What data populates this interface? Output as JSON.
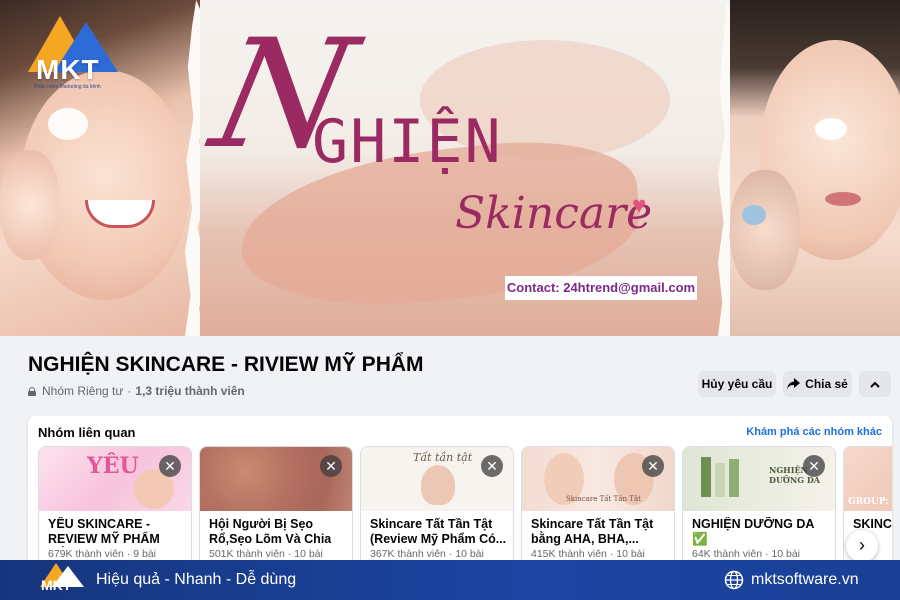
{
  "logo": {
    "text": "MKT",
    "tagline": "Phần mềm Marketing đa kênh"
  },
  "cover": {
    "brand_initial": "N",
    "brand_title": "GHIỆN",
    "brand_subtitle": "Skincare",
    "contact": "Contact: 24htrend@gmail.com"
  },
  "group": {
    "name": "NGHIỆN SKINCARE - RIVIEW MỸ PHẨM",
    "privacy": "Nhóm Riêng tư",
    "separator": "·",
    "members": "1,3 triệu thành viên"
  },
  "actions": {
    "cancel_request": "Hủy yêu cầu",
    "share": "Chia sẻ",
    "collapse_icon": "chevron-up-icon"
  },
  "related": {
    "title": "Nhóm liên quan",
    "explore_link": "Khám phá các nhóm khác",
    "cards": [
      {
        "name": "YÊU SKINCARE - REVIEW MỸ PHẨM CÓ...",
        "members": "679K thành viên",
        "posts": "9 bài",
        "thumb_text": "YÊU"
      },
      {
        "name": "Hội Người Bị Sẹo Rổ,Sẹo Lõm Và Chia S...",
        "members": "501K thành viên",
        "posts": "10 bài",
        "thumb_text": ""
      },
      {
        "name": "Skincare Tất Tần Tật (Review Mỹ Phẩm Có...",
        "members": "367K thành viên",
        "posts": "10 bài",
        "thumb_text": "Tất tần tật"
      },
      {
        "name": "Skincare Tất Tần Tật bằng AHA, BHA,...",
        "members": "415K thành viên",
        "posts": "10 bài",
        "thumb_text": "Skincare Tất Tần Tật"
      },
      {
        "name": "NGHIỆN DƯỠNG DA ✅",
        "members": "64K thành viên",
        "posts": "10 bài",
        "thumb_text": "NGHIỆN DƯỠNG DA"
      },
      {
        "name": "SKINCA",
        "members": "",
        "posts": "",
        "thumb_text": "GROUP: SK"
      }
    ]
  },
  "banner": {
    "logo_text": "MKT",
    "slogan": "Hiệu quả - Nhanh - Dễ dùng",
    "website": "mktsoftware.vn"
  },
  "colors": {
    "brand_purple": "#9b2a63",
    "link_blue": "#216fdb",
    "banner_blue": "#1c46a3",
    "logo_orange": "#f5a623"
  }
}
